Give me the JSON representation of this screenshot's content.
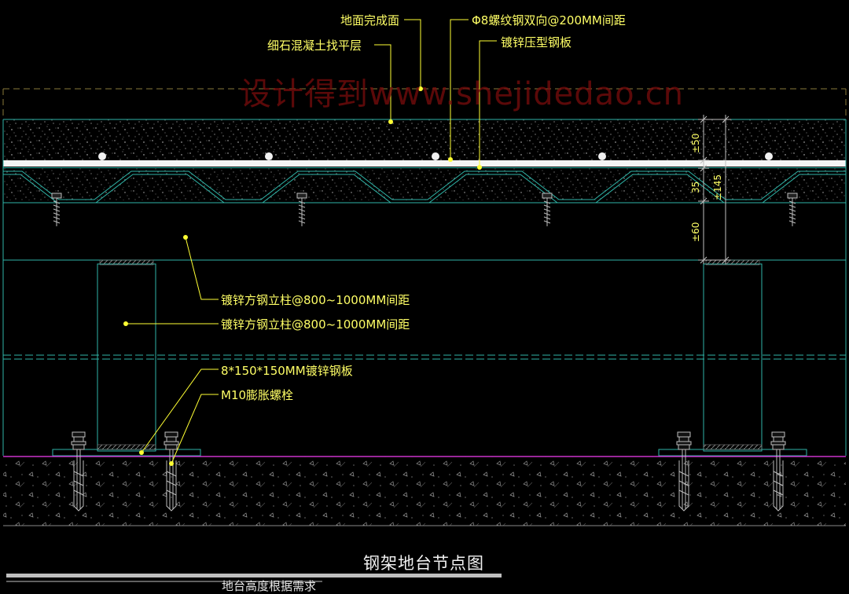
{
  "watermark": "设计得到www.shejidedao.cn",
  "labels": {
    "finish_surface": "地面完成面",
    "leveling_layer": "细石混凝土找平层",
    "rebar": "Φ8螺纹钢双向@200MM间距",
    "deck": "镀锌压型钢板",
    "column_1": "镀锌方钢立柱@800~1000MM间距",
    "column_2": "镀锌方钢立柱@800~1000MM间距",
    "steel_plate": "8*150*150MM镀锌钢板",
    "bolt": "M10膨胀螺栓"
  },
  "dimensions": {
    "d50": "±50",
    "d35": "35",
    "d60": "±60",
    "d145": "±145"
  },
  "title": "钢架地台节点图",
  "subtitle": "地台高度根据需求",
  "colors": {
    "linework": "#2fb5a8",
    "leader": "#ffff33",
    "ground_line": "#cc33cc",
    "dashed": "#8a7a3a",
    "concrete_speckle": "#c9c9c9"
  }
}
